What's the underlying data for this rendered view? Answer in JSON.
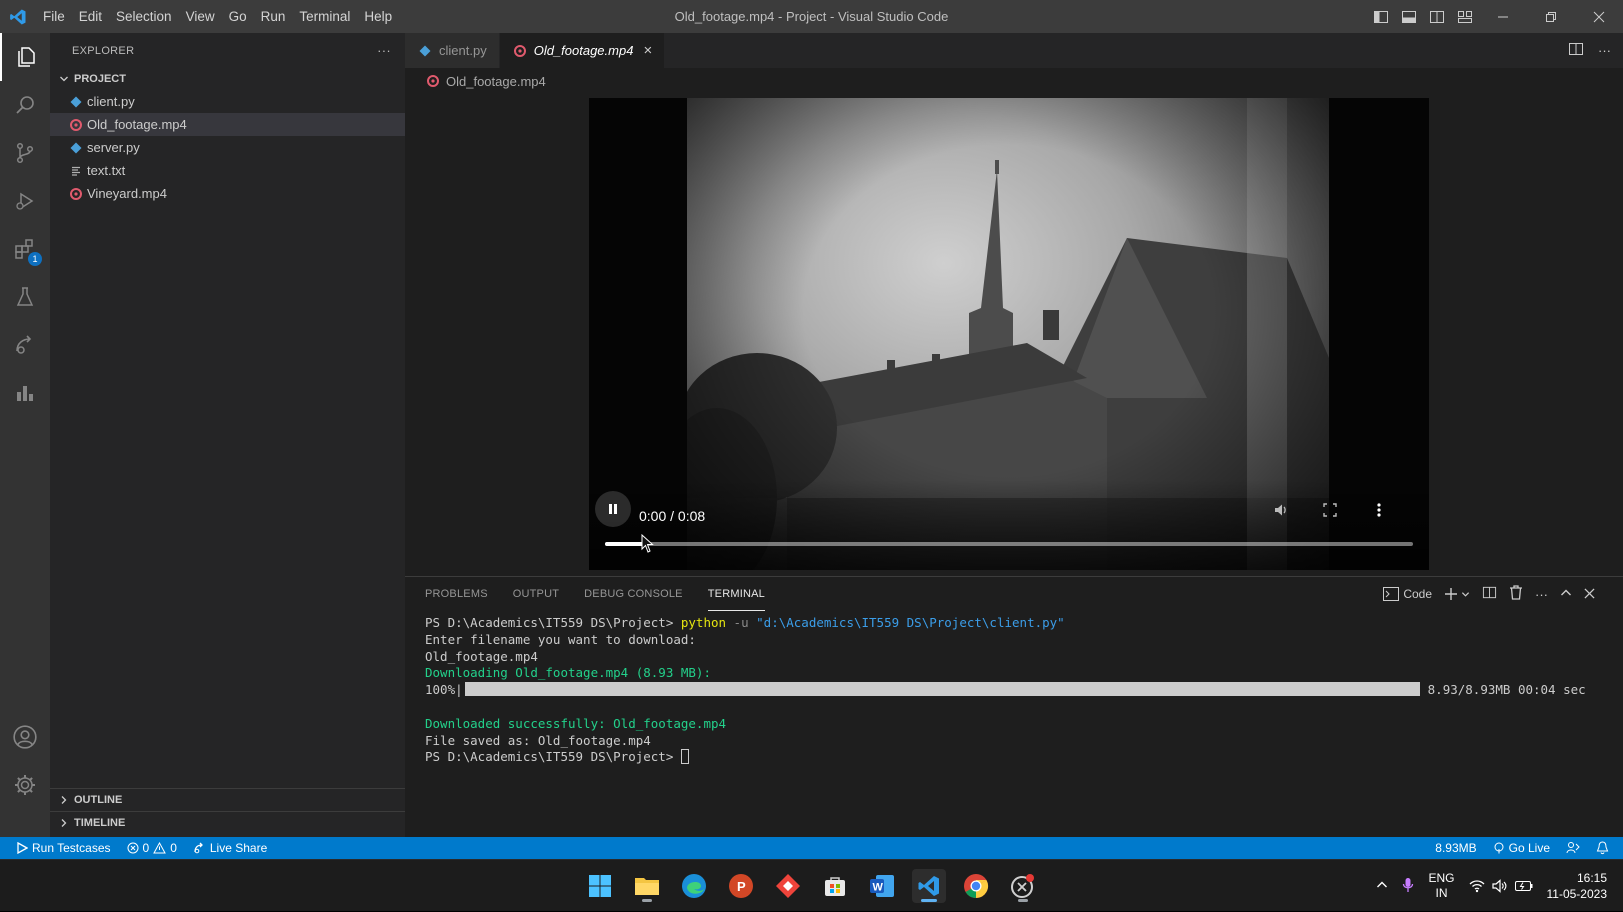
{
  "window": {
    "title": "Old_footage.mp4 - Project - Visual Studio Code",
    "menu": [
      "File",
      "Edit",
      "Selection",
      "View",
      "Go",
      "Run",
      "Terminal",
      "Help"
    ]
  },
  "explorer": {
    "header": "EXPLORER",
    "more": "···",
    "section_title": "PROJECT",
    "files": [
      {
        "name": "client.py",
        "icon": "python-icon"
      },
      {
        "name": "Old_footage.mp4",
        "icon": "video-file-icon",
        "selected": true
      },
      {
        "name": "server.py",
        "icon": "python-icon"
      },
      {
        "name": "text.txt",
        "icon": "text-file-icon"
      },
      {
        "name": "Vineyard.mp4",
        "icon": "video-file-icon"
      }
    ],
    "outline": "OUTLINE",
    "timeline": "TIMELINE"
  },
  "activity": {
    "extensions_badge": "1"
  },
  "tabs": [
    {
      "label": "client.py",
      "active": false
    },
    {
      "label": "Old_footage.mp4",
      "active": true,
      "close": "×"
    }
  ],
  "breadcrumb": "Old_footage.mp4",
  "video": {
    "time": "0:00 / 0:08",
    "progress": 0.05
  },
  "panel": {
    "tabs": [
      "PROBLEMS",
      "OUTPUT",
      "DEBUG CONSOLE",
      "TERMINAL"
    ],
    "active_tab": "TERMINAL",
    "shell_label": "Code",
    "terminal": {
      "prompt1": "PS D:\\Academics\\IT559 DS\\Project> ",
      "cmd": "python",
      "flag": " -u ",
      "arg": "\"d:\\Academics\\IT559 DS\\Project\\client.py\"",
      "line2": "Enter filename you want to download:",
      "line3": "Old_footage.mp4",
      "line4": "Downloading Old_footage.mp4 (8.93 MB):",
      "progress_pct": "100%|",
      "progress_stats": "8.93/8.93MB 00:04 sec",
      "line6": "Downloaded successfully: Old_footage.mp4",
      "line7": "File saved as: Old_footage.mp4",
      "prompt2": "PS D:\\Academics\\IT559 DS\\Project> "
    }
  },
  "statusbar": {
    "run_testcases": "Run Testcases",
    "errors": "0",
    "warnings": "0",
    "live_share": "Live Share",
    "size": "8.93MB",
    "go_live": "Go Live"
  },
  "taskbar": {
    "lang_top": "ENG",
    "lang_bottom": "IN",
    "time": "16:15",
    "date": "11-05-2023"
  },
  "colors": {
    "accent": "#007acc",
    "terminal_green": "#23d18b",
    "terminal_yellow": "#e5e510"
  }
}
